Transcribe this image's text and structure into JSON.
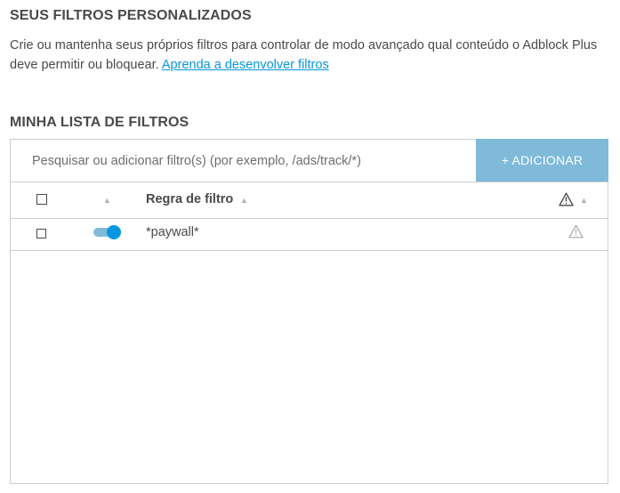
{
  "custom_filters": {
    "heading": "SEUS FILTROS PERSONALIZADOS",
    "description": "Crie ou mantenha seus próprios filtros para controlar de modo avançado qual conteúdo o Adblock Plus deve permitir ou bloquear.",
    "learn_link": "Aprenda a desenvolver filtros"
  },
  "filter_list": {
    "heading": "MINHA LISTA DE FILTROS",
    "search_placeholder": "Pesquisar ou adicionar filtro(s) (por exemplo, /ads/track/*)",
    "search_value": "",
    "add_button_label": "+ ADICIONAR",
    "columns": {
      "rule_label": "Regra de filtro",
      "sort_icon": "sort-up-icon",
      "warning_icon": "warning-triangle-icon"
    },
    "rows": [
      {
        "rule": "*paywall*",
        "enabled": true,
        "selected": false,
        "warning_icon": "warning-triangle-icon"
      }
    ]
  },
  "colors": {
    "accent": "#0797e1",
    "accent_light": "#7fbad9",
    "text": "#4a4a4a",
    "border": "#cdcdcd",
    "muted_icon": "#b0b0b0"
  }
}
